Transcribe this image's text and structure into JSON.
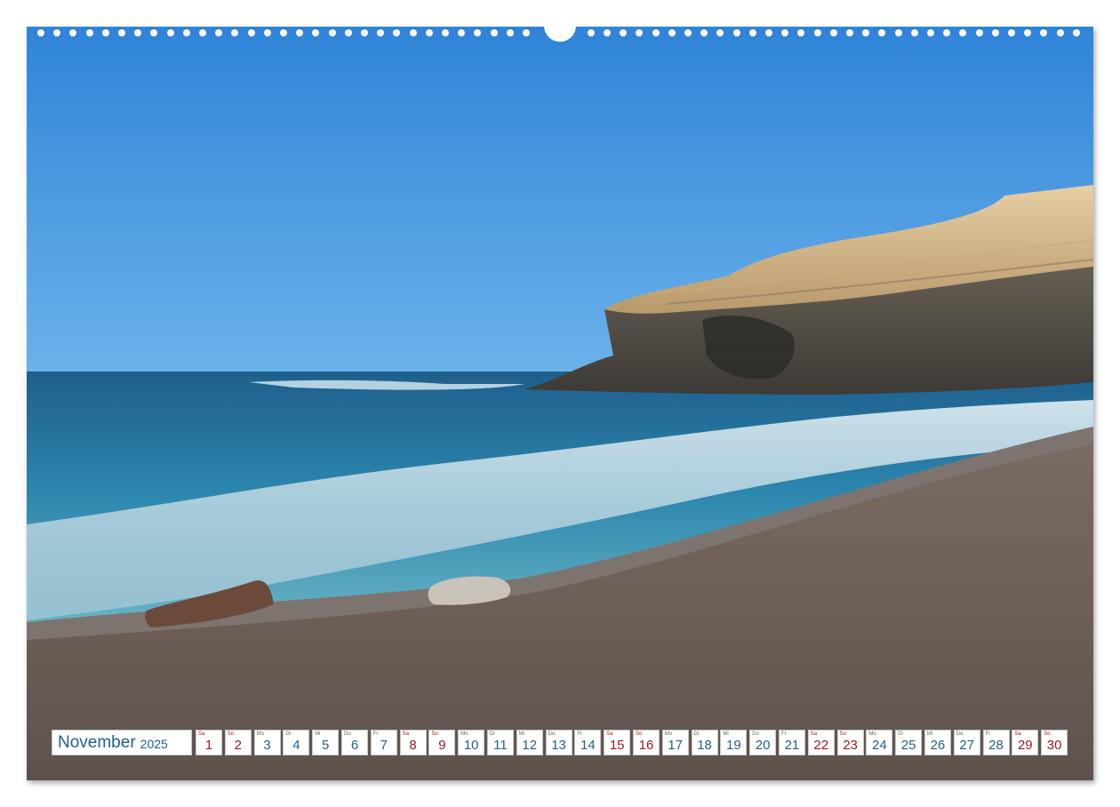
{
  "calendar": {
    "month": "November",
    "year": "2025",
    "days": [
      {
        "wd": "Sa",
        "n": "1",
        "weekend": true
      },
      {
        "wd": "So",
        "n": "2",
        "weekend": true
      },
      {
        "wd": "Mo",
        "n": "3",
        "weekend": false
      },
      {
        "wd": "Di",
        "n": "4",
        "weekend": false
      },
      {
        "wd": "Mi",
        "n": "5",
        "weekend": false
      },
      {
        "wd": "Do",
        "n": "6",
        "weekend": false
      },
      {
        "wd": "Fr",
        "n": "7",
        "weekend": false
      },
      {
        "wd": "Sa",
        "n": "8",
        "weekend": true
      },
      {
        "wd": "So",
        "n": "9",
        "weekend": true
      },
      {
        "wd": "Mo",
        "n": "10",
        "weekend": false
      },
      {
        "wd": "Di",
        "n": "11",
        "weekend": false
      },
      {
        "wd": "Mi",
        "n": "12",
        "weekend": false
      },
      {
        "wd": "Do",
        "n": "13",
        "weekend": false
      },
      {
        "wd": "Fr",
        "n": "14",
        "weekend": false
      },
      {
        "wd": "Sa",
        "n": "15",
        "weekend": true
      },
      {
        "wd": "So",
        "n": "16",
        "weekend": true
      },
      {
        "wd": "Mo",
        "n": "17",
        "weekend": false
      },
      {
        "wd": "Di",
        "n": "18",
        "weekend": false
      },
      {
        "wd": "Mi",
        "n": "19",
        "weekend": false
      },
      {
        "wd": "Do",
        "n": "20",
        "weekend": false
      },
      {
        "wd": "Fr",
        "n": "21",
        "weekend": false
      },
      {
        "wd": "Sa",
        "n": "22",
        "weekend": true
      },
      {
        "wd": "So",
        "n": "23",
        "weekend": true
      },
      {
        "wd": "Mo",
        "n": "24",
        "weekend": false
      },
      {
        "wd": "Di",
        "n": "25",
        "weekend": false
      },
      {
        "wd": "Mi",
        "n": "26",
        "weekend": false
      },
      {
        "wd": "Do",
        "n": "27",
        "weekend": false
      },
      {
        "wd": "Fr",
        "n": "28",
        "weekend": false
      },
      {
        "wd": "Sa",
        "n": "29",
        "weekend": true
      },
      {
        "wd": "So",
        "n": "30",
        "weekend": true
      }
    ]
  },
  "colors": {
    "weekday": "#1f5f8f",
    "weekend": "#a01818",
    "sky": "#3f8fd8",
    "sand": "#6f625c"
  }
}
